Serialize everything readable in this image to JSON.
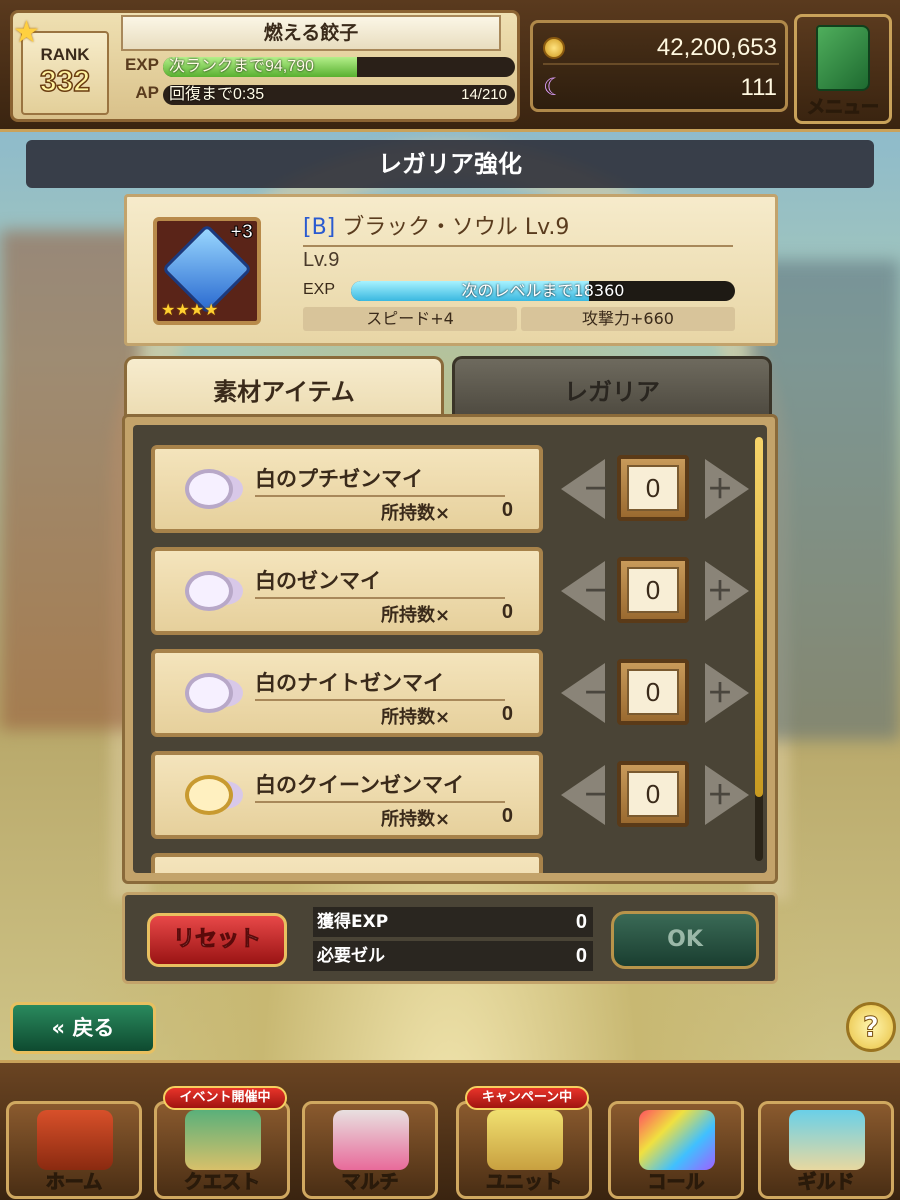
{
  "player": {
    "name": "燃える餃子",
    "rank_label": "RANK",
    "rank_value": "332",
    "exp_key": "EXP",
    "exp_text": "次ランクまで94,790",
    "exp_progress": 0.55,
    "ap_key": "AP",
    "ap_text": "回復まで0:35",
    "ap_count": "14/210",
    "ap_progress": 0.07
  },
  "currency": {
    "gold": "42,200,653",
    "moon": "111",
    "gold_icon": "coin-icon",
    "moon_icon": "crescent-moon-icon"
  },
  "menu": {
    "label": "メニュー",
    "icon": "book-icon"
  },
  "page_title": "レガリア強化",
  "item": {
    "rank_tag": "[B]",
    "name": " ブラック・ソウル Lv.9",
    "plus": "+3",
    "stars": "★★★★",
    "level": "Lv.9",
    "exp_key": "EXP",
    "exp_text": "次のレベルまで18360",
    "exp_progress": 0.62,
    "bonus_speed": "スピード+4",
    "bonus_attack": "攻撃力+660"
  },
  "tabs": {
    "materials": "素材アイテム",
    "regalia": "レガリア"
  },
  "materials": [
    {
      "name": "白のプチゼンマイ",
      "owned_label": "所持数×",
      "owned": "0",
      "qty": "0"
    },
    {
      "name": "白のゼンマイ",
      "owned_label": "所持数×",
      "owned": "0",
      "qty": "0"
    },
    {
      "name": "白のナイトゼンマイ",
      "owned_label": "所持数×",
      "owned": "0",
      "qty": "0"
    },
    {
      "name": "白のクイーンゼンマイ",
      "owned_label": "所持数×",
      "owned": "0",
      "qty": "0"
    }
  ],
  "stepper": {
    "minus": "－",
    "plus": "＋"
  },
  "summary": {
    "reset_label": "リセット",
    "gain_exp_label": "獲得EXP",
    "gain_exp_value": "0",
    "cost_label": "必要ゼル",
    "cost_value": "0",
    "ok_label": "OK"
  },
  "footer": {
    "back_label": "戻る",
    "back_icon": "double-chevron-left-icon",
    "help_label": "?"
  },
  "nav": [
    {
      "label": "ホーム",
      "badge": ""
    },
    {
      "label": "クエスト",
      "badge": "イベント開催中"
    },
    {
      "label": "マルチ",
      "badge": ""
    },
    {
      "label": "ユニット",
      "badge": "キャンペーン中"
    },
    {
      "label": "コール",
      "badge": ""
    },
    {
      "label": "ギルド",
      "badge": ""
    }
  ]
}
